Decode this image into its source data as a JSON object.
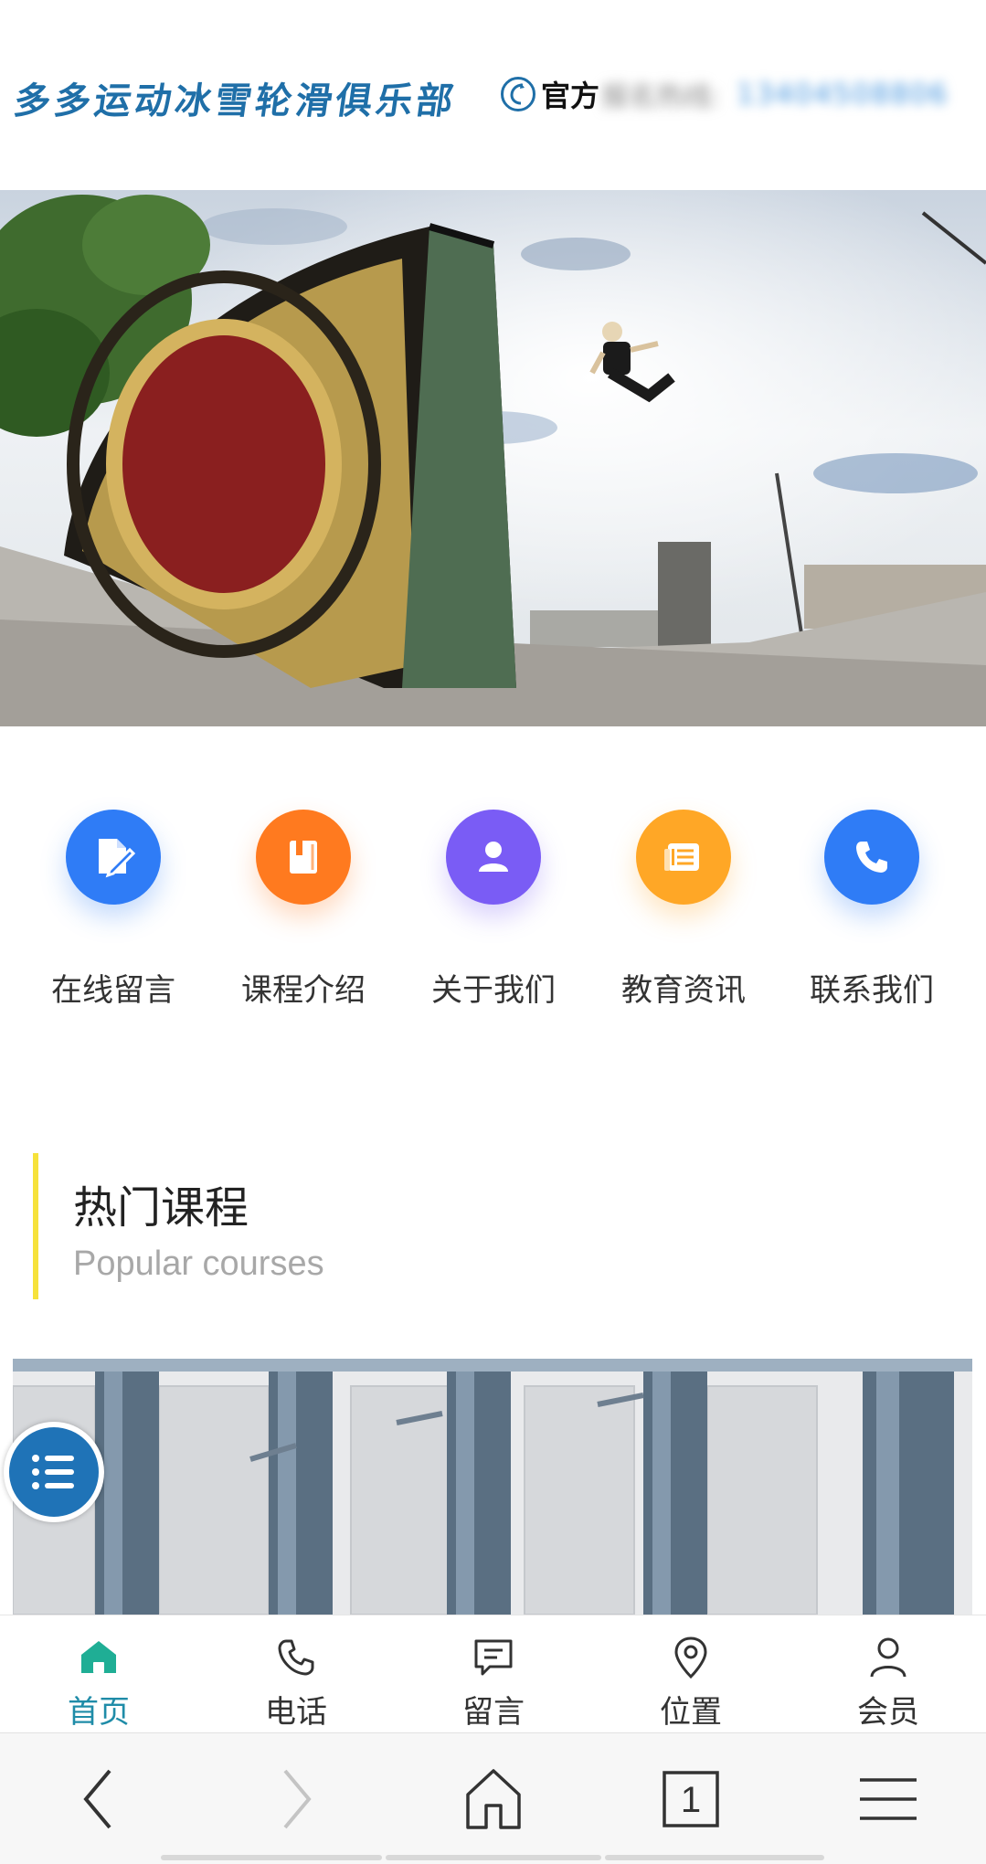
{
  "header": {
    "club_name": "多多运动冰雪轮滑俱乐部",
    "hotline_label": "官方",
    "hotline_blurred": "报名热线:",
    "hotline_number": "13404508806"
  },
  "quick_nav": [
    {
      "label": "在线留言",
      "icon": "edit-icon",
      "color": "#2f7cf6"
    },
    {
      "label": "课程介绍",
      "icon": "book-icon",
      "color": "#ff7a1f"
    },
    {
      "label": "关于我们",
      "icon": "user-icon",
      "color": "#7a5cf5"
    },
    {
      "label": "教育资讯",
      "icon": "news-icon",
      "color": "#ffa726"
    },
    {
      "label": "联系我们",
      "icon": "phone-icon",
      "color": "#2f7cf6"
    }
  ],
  "section": {
    "title": "热门课程",
    "subtitle": "Popular courses",
    "accent": "#f6e23b"
  },
  "bottom_nav": [
    {
      "label": "首页",
      "icon": "home-icon",
      "active": true
    },
    {
      "label": "电话",
      "icon": "phone-icon"
    },
    {
      "label": "留言",
      "icon": "message-icon"
    },
    {
      "label": "位置",
      "icon": "location-icon"
    },
    {
      "label": "会员",
      "icon": "member-icon"
    }
  ],
  "browser_bar": {
    "tab_count": "1",
    "items": [
      "back-icon",
      "forward-icon",
      "home-icon",
      "tabs-icon",
      "menu-icon"
    ]
  },
  "colors": {
    "brand_blue": "#1f73b7",
    "active_nav": "#1f8ca8"
  }
}
